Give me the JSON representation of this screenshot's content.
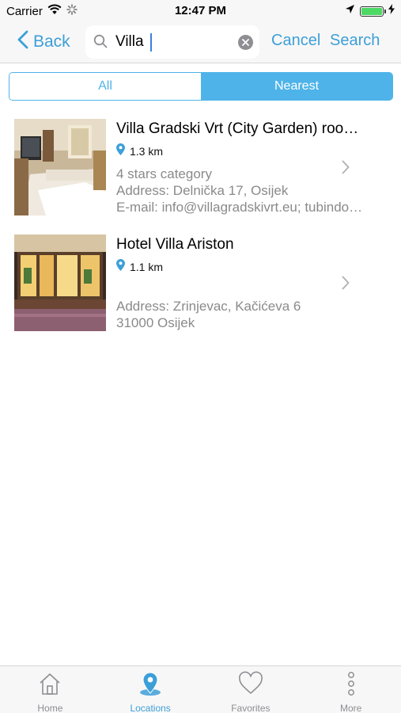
{
  "status_bar": {
    "carrier": "Carrier",
    "time": "12:47 PM",
    "battery_level": 1.0
  },
  "nav": {
    "back_label": "Back",
    "search_value": "Villa",
    "cancel_label": "Cancel",
    "search_label": "Search"
  },
  "segments": {
    "all_label": "All",
    "nearest_label": "Nearest",
    "selected": "Nearest"
  },
  "results": [
    {
      "title": "Villa Gradski Vrt (City Garden) roo…",
      "distance": "1.3 km",
      "line1": "4 stars category",
      "line2": "Address: Delnička 17, Osijek",
      "line3": "E-mail: info@villagradskivrt.eu; tubindo…",
      "image": "hotel-room-photo"
    },
    {
      "title": "Hotel Villa Ariston",
      "distance": "1.1 km",
      "line1": "Address: Zrinjevac, Kačićeva 6",
      "line2": "31000 Osijek",
      "image": "hotel-facade-photo"
    }
  ],
  "tab_bar": {
    "home_label": "Home",
    "locations_label": "Locations",
    "favorites_label": "Favorites",
    "more_label": "More",
    "active_tab": "Locations"
  },
  "colors": {
    "accent": "#3d9fd8",
    "segment": "#4eb3e8",
    "inactive_tab": "#8e8e93",
    "secondary_text": "#8a8a8a"
  }
}
